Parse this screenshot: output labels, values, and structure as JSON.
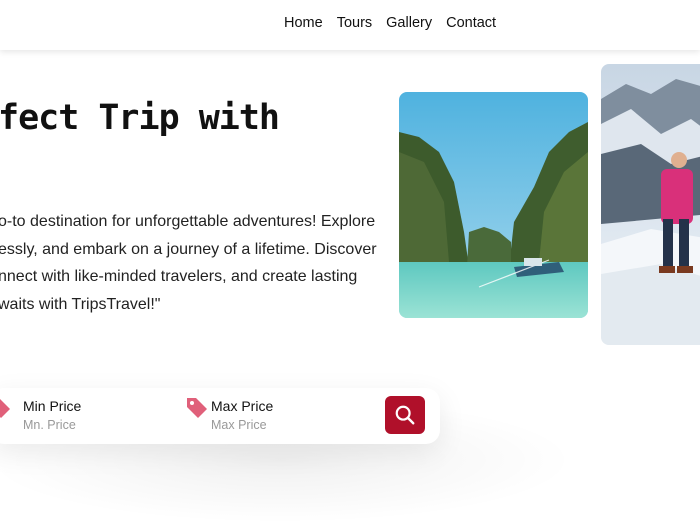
{
  "nav": {
    "links": [
      "Home",
      "Tours",
      "Gallery",
      "Contact"
    ]
  },
  "hero": {
    "title": "fect Trip with",
    "description_lines": [
      "o-to destination for unforgettable adventures! Explore",
      "essly, and embark on a journey of a lifetime. Discover",
      "nnect with like-minded travelers, and create lasting",
      "waits with TripsTravel!\""
    ]
  },
  "search": {
    "min_price": {
      "label": "Min Price",
      "placeholder": "Mn. Price"
    },
    "max_price": {
      "label": "Max Price",
      "placeholder": "Max Price"
    },
    "icons": {
      "price_field": "tag-icon",
      "submit": "search-icon"
    }
  },
  "colors": {
    "accent": "#b0102a",
    "tag_icon": "#e0607a"
  }
}
